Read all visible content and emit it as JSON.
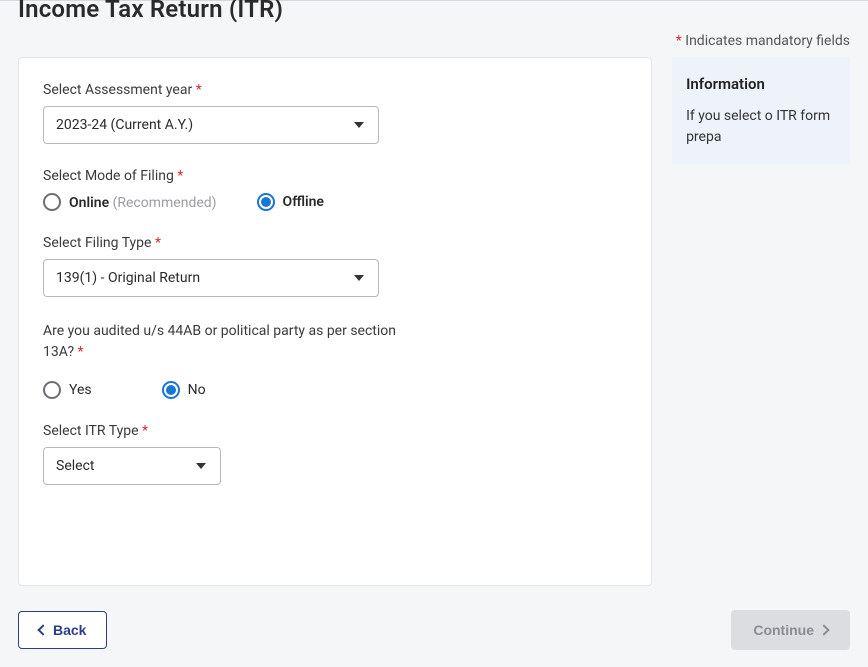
{
  "page": {
    "title": "Income Tax Return (ITR)",
    "mandatoryPrefix": "*",
    "mandatoryText": " Indicates mandatory fields"
  },
  "form": {
    "assessmentYear": {
      "label": "Select Assessment year ",
      "value": "2023-24 (Current A.Y.)"
    },
    "modeOfFiling": {
      "label": "Select Mode of Filing  ",
      "options": {
        "online": {
          "label": "Online",
          "sublabel": " (Recommended)",
          "selected": false
        },
        "offline": {
          "label": "Offline",
          "selected": true
        }
      }
    },
    "filingType": {
      "label": "Select Filing Type ",
      "value": "139(1) - Original Return"
    },
    "auditQuestion": {
      "label": "Are you audited u/s 44AB or political party as per section 13A? ",
      "options": {
        "yes": {
          "label": "Yes",
          "selected": false
        },
        "no": {
          "label": "No",
          "selected": true
        }
      }
    },
    "itrType": {
      "label": "Select ITR Type ",
      "value": "Select"
    }
  },
  "info": {
    "title": "Information",
    "body": "If you select o ITR form prepa"
  },
  "buttons": {
    "back": "Back",
    "continue": "Continue"
  }
}
